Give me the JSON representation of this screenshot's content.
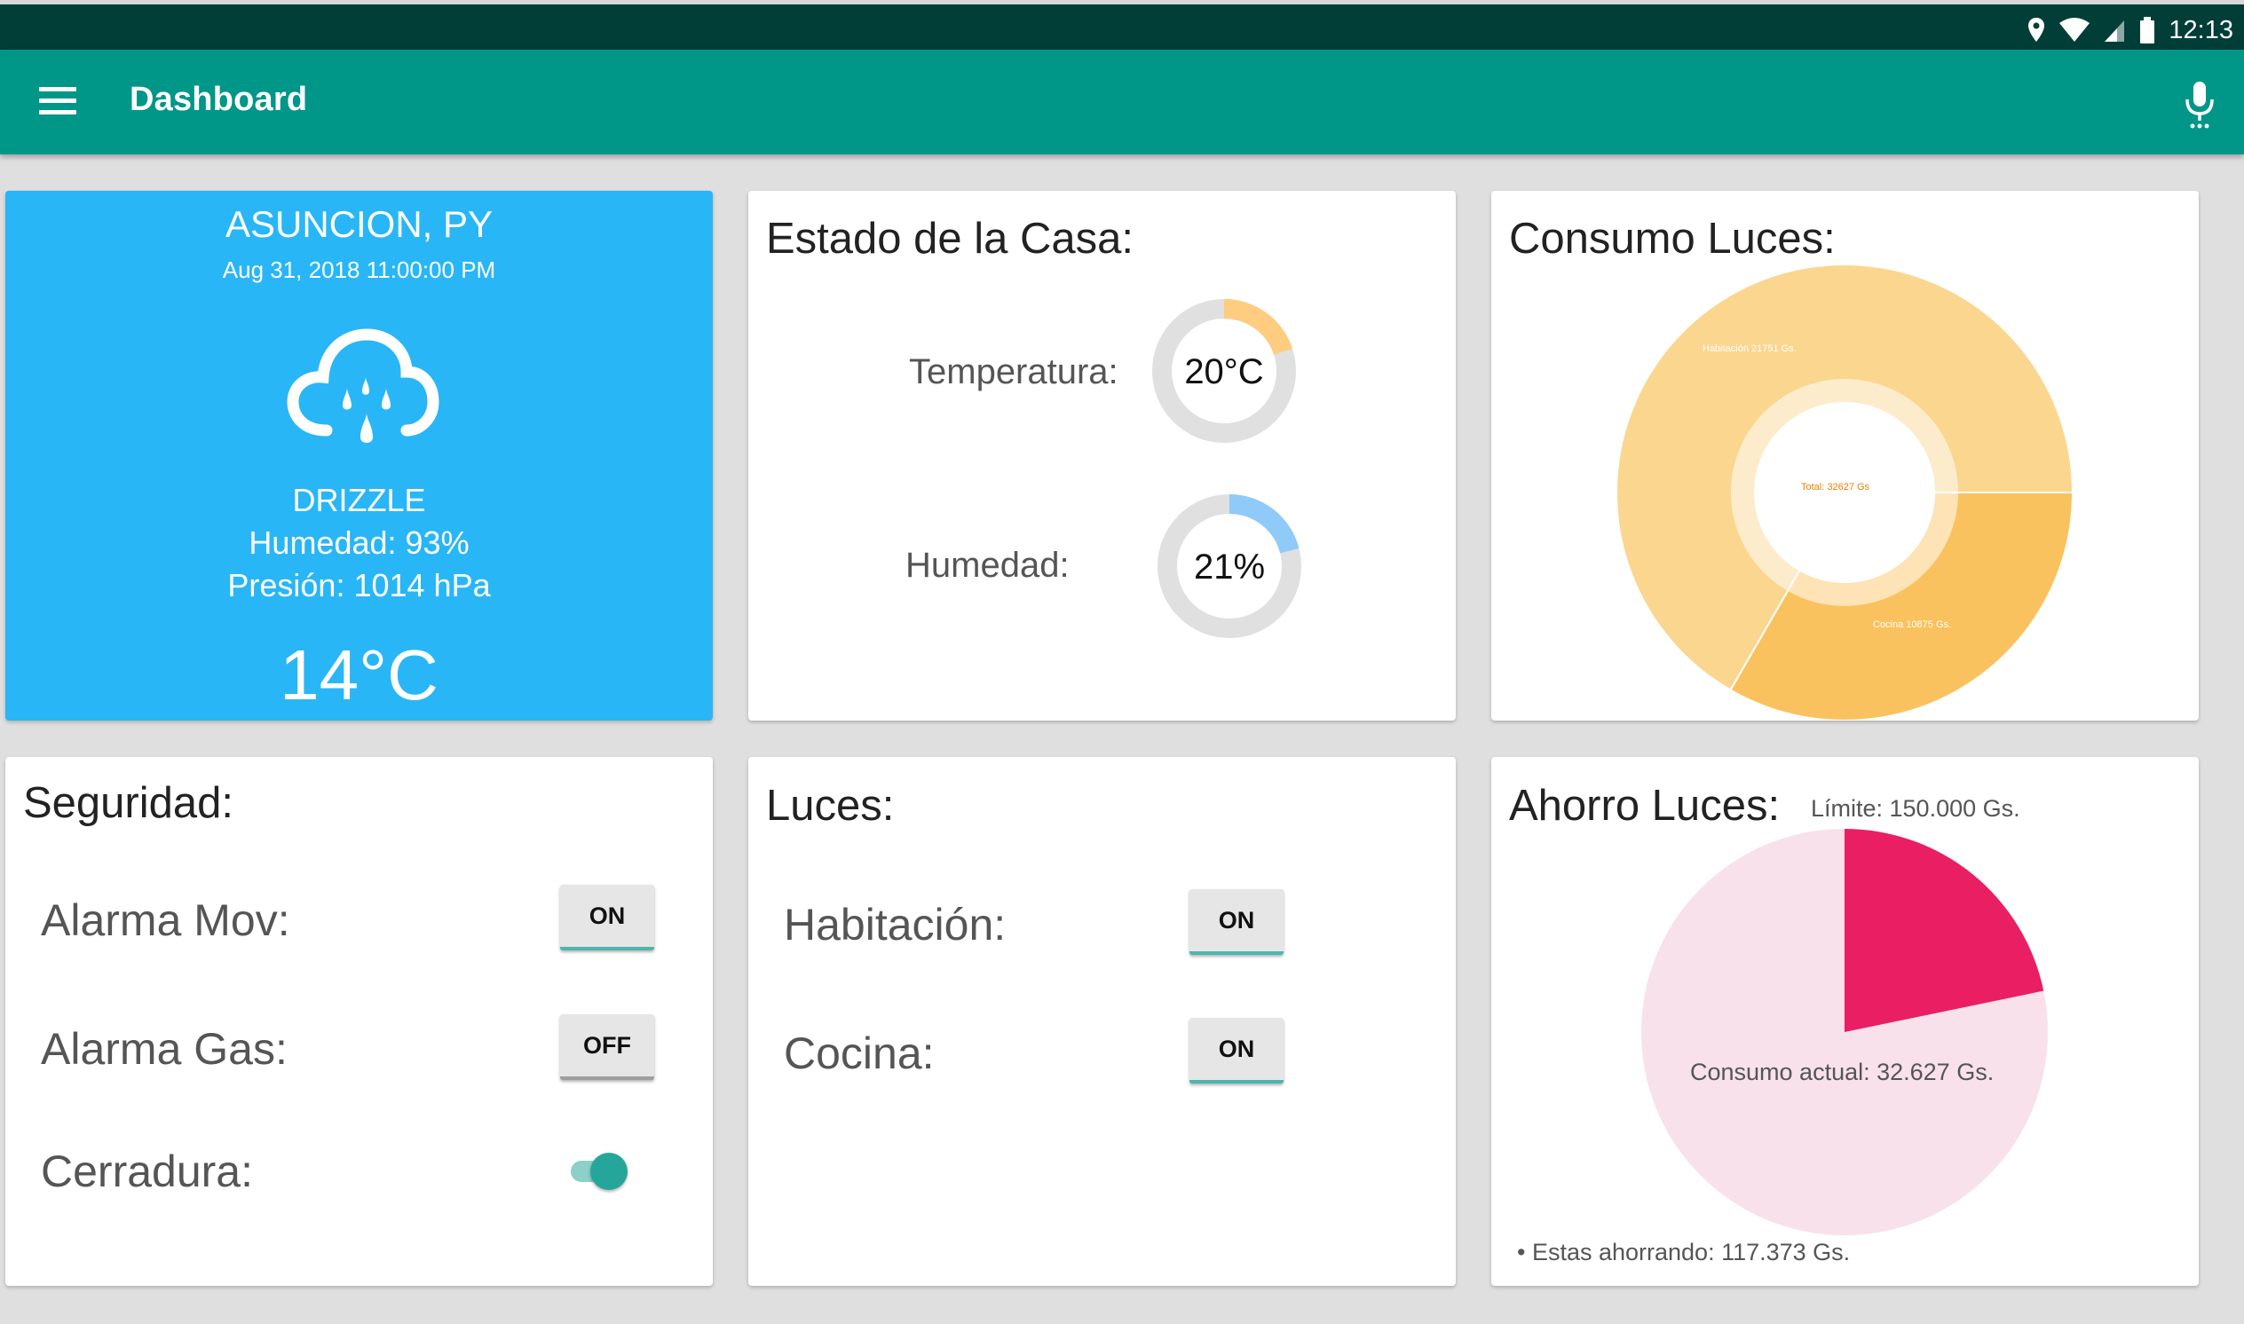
{
  "status_bar": {
    "time": "12:13",
    "icons": [
      "location-icon",
      "wifi-icon",
      "signal-icon",
      "battery-icon"
    ]
  },
  "app_bar": {
    "title": "Dashboard",
    "menu_icon": "menu-icon",
    "mic_icon": "mic-icon"
  },
  "weather": {
    "city": "ASUNCION, PY",
    "datetime": "Aug 31, 2018 11:00:00 PM",
    "icon": "drizzle-cloud-icon",
    "description": "DRIZZLE",
    "humidity": "Humedad: 93%",
    "pressure": "Presión: 1014 hPa",
    "temperature": "14°C",
    "color": "#29b6f6"
  },
  "estado": {
    "title": "Estado de la Casa:",
    "temperature": {
      "label": "Temperatura:",
      "value": "20°C",
      "fraction": 0.2,
      "color": "#ffcc80"
    },
    "humidity": {
      "label": "Humedad:",
      "value": "21%",
      "fraction": 0.21,
      "color": "#90caf9"
    }
  },
  "consumo": {
    "title": "Consumo Luces:",
    "total_label": "Total: 32627 Gs",
    "slices": [
      {
        "label": "Habitación 21751 Gs.",
        "value": 21751,
        "color": "#fbd68f"
      },
      {
        "label": "Cocina 10875 Gs.",
        "value": 10875,
        "color": "#fac25e"
      }
    ]
  },
  "seguridad": {
    "title": "Seguridad:",
    "rows": [
      {
        "label": "Alarma Mov:",
        "button": "ON",
        "state": "on"
      },
      {
        "label": "Alarma Gas:",
        "button": "OFF",
        "state": "off"
      },
      {
        "label": "Cerradura:",
        "switch": true
      }
    ]
  },
  "luces": {
    "title": "Luces:",
    "rows": [
      {
        "label": "Habitación:",
        "button": "ON"
      },
      {
        "label": "Cocina:",
        "button": "ON"
      }
    ]
  },
  "ahorro": {
    "title": "Ahorro Luces:",
    "limit": "Límite: 150.000 Gs.",
    "consumo_label": "Consumo actual: 32.627 Gs.",
    "ahorro_label": "• Estas ahorrando: 117.373 Gs.",
    "consumed_fraction": 0.2175,
    "colors": {
      "consumed": "#e91e63",
      "remaining": "#f8e1ea"
    }
  }
}
